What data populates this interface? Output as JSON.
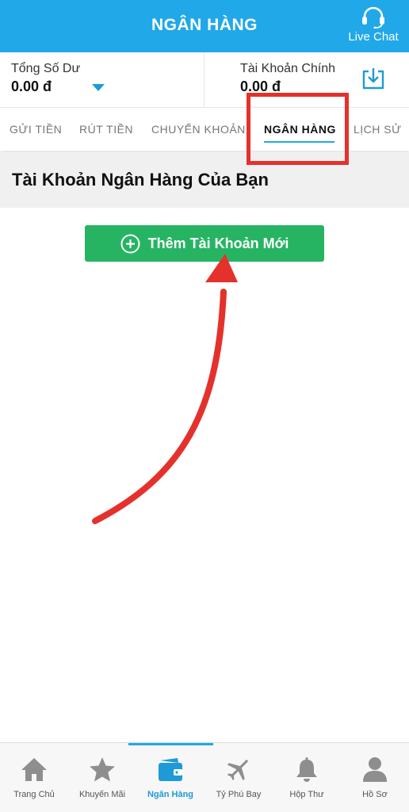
{
  "header": {
    "title": "NGÂN HÀNG",
    "live_chat": "Live Chat"
  },
  "balance": {
    "total_label": "Tổng Số Dư",
    "total_value": "0.00 đ",
    "main_label": "Tài Khoản Chính",
    "main_value": "0.00 đ"
  },
  "tabs": [
    {
      "label": "GỬI TIỀN"
    },
    {
      "label": "RÚT TIỀN"
    },
    {
      "label": "CHUYỂN KHOẢN"
    },
    {
      "label": "NGÂN HÀNG",
      "active": true
    },
    {
      "label": "LỊCH SỬ"
    }
  ],
  "section": {
    "title": "Tài Khoản Ngân Hàng Của Bạn"
  },
  "add_button": {
    "label": "Thêm Tài Khoản Mới"
  },
  "bottom_nav": [
    {
      "label": "Trang Chủ",
      "icon": "home-icon"
    },
    {
      "label": "Khuyến Mãi",
      "icon": "star-icon"
    },
    {
      "label": "Ngân Hàng",
      "icon": "wallet-icon",
      "active": true
    },
    {
      "label": "Tỷ Phú Bay",
      "icon": "plane-icon"
    },
    {
      "label": "Hộp Thư",
      "icon": "bell-icon"
    },
    {
      "label": "Hồ Sơ",
      "icon": "user-icon"
    }
  ],
  "colors": {
    "header_blue": "#20a8e8",
    "button_green": "#26b463",
    "annotation_red": "#e5312c",
    "nav_active": "#1e9ad6"
  }
}
